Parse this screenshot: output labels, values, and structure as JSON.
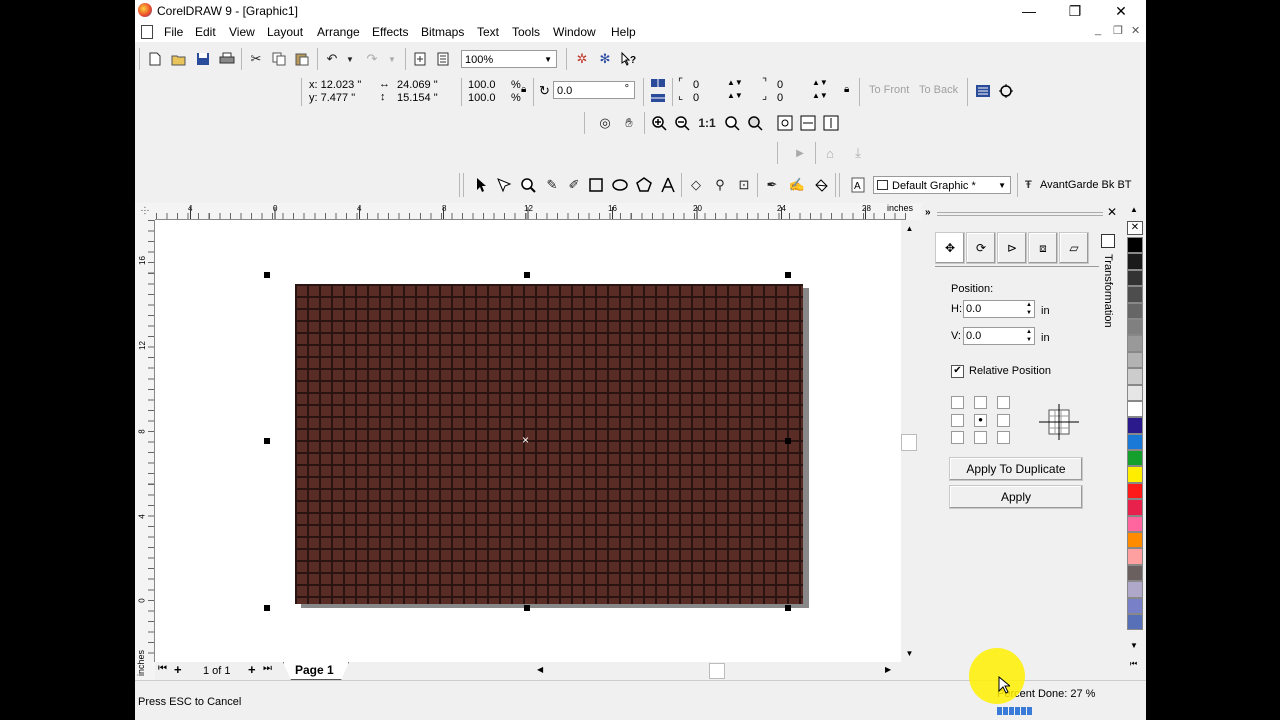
{
  "window": {
    "title": "CorelDRAW 9 - [Graphic1]",
    "minimize_glyph": "—",
    "restore_glyph": "❐",
    "close_glyph": "✕"
  },
  "menu": {
    "items": [
      "File",
      "Edit",
      "View",
      "Layout",
      "Arrange",
      "Effects",
      "Bitmaps",
      "Text",
      "Tools",
      "Window",
      "Help"
    ],
    "mdi_min": "_",
    "mdi_restore": "❐",
    "mdi_close": "✕"
  },
  "standard_toolbar": {
    "zoom_value": "100%"
  },
  "property_bar": {
    "x": "x: 12.023 \"",
    "y": "y: 7.477 \"",
    "width": "24.069 \"",
    "height": "15.154 \"",
    "scale_x": "100.0",
    "scale_y": "100.0",
    "percent_x": "%",
    "percent_y": "%",
    "rotation": "0.0",
    "degree": "°",
    "corner_tl": "0",
    "corner_bl": "0",
    "corner_tr": "0",
    "corner_br": "0",
    "to_front": "To Front",
    "to_back": "To Back"
  },
  "zoom_toolbar": {
    "one_to_one": "1:1"
  },
  "toolbox": {
    "style_value": "Default Graphic *",
    "font_value": "AvantGarde Bk BT"
  },
  "ruler": {
    "unit": "inches",
    "h_labels": [
      "4",
      "0",
      "4",
      "8",
      "12",
      "16",
      "20",
      "24",
      "28"
    ],
    "v_labels": [
      "16",
      "12",
      "8",
      "4",
      "0"
    ],
    "v_unit": "inches"
  },
  "page_nav": {
    "page_count": "1 of 1",
    "page_tab": "Page 1"
  },
  "transformation": {
    "tab_label": "Transformation",
    "position_label": "Position:",
    "h_label": "H:",
    "h_value": "0.0",
    "v_label": "V:",
    "v_value": "0.0",
    "unit": "in",
    "relative_position_label": "Relative Position",
    "relative_checked": "✔",
    "apply_duplicate": "Apply To Duplicate",
    "apply": "Apply",
    "close_glyph": "✕",
    "collapse_glyph": "»"
  },
  "palette": {
    "colors": [
      "#000000",
      "#1a1a1a",
      "#333333",
      "#4d4d4d",
      "#666666",
      "#808080",
      "#999999",
      "#b3b3b3",
      "#cccccc",
      "#e6e6e6",
      "#ffffff",
      "#2b1a8c",
      "#1a78d6",
      "#15a02e",
      "#ffee00",
      "#ff1a1a",
      "#e8204c",
      "#ff66a0",
      "#ff8c00",
      "#ffa0a0",
      "#6b6060",
      "#b0a8c8",
      "#7880c8",
      "#5870b8"
    ]
  },
  "status": {
    "message": "Press ESC to Cancel",
    "percent_done": "Percent Done:  27 %",
    "progress": 0.27
  },
  "object": {
    "fill": "#5a2c26",
    "mortar": "#2a1411"
  }
}
